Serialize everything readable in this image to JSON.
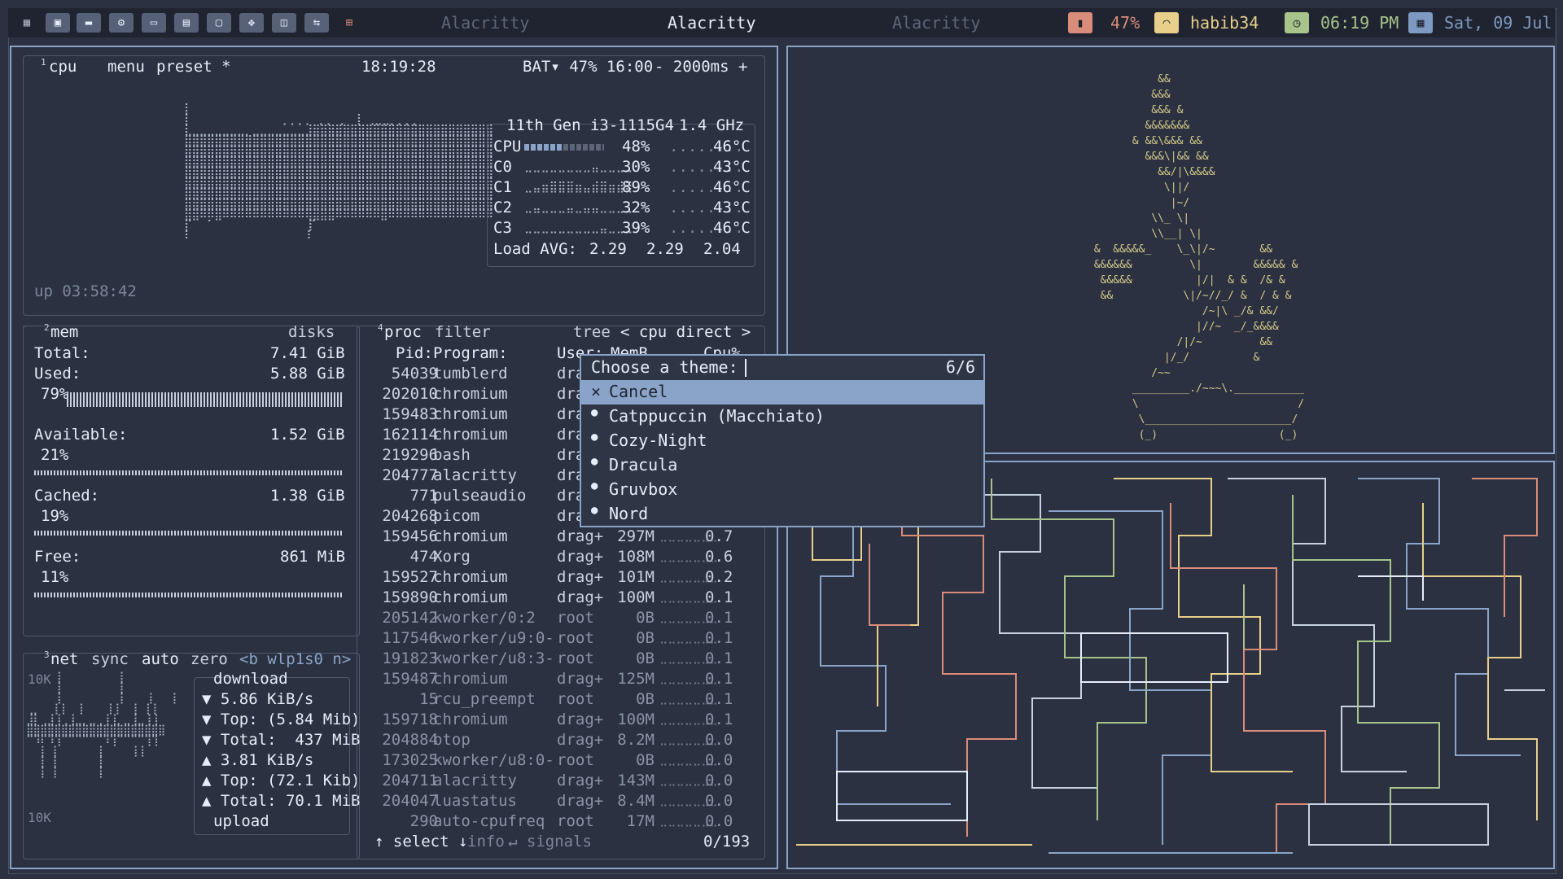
{
  "topbar": {
    "workspace_icons": [
      "grid-icon",
      "terminal-icon",
      "folder-icon",
      "gear-icon",
      "window-icon",
      "book-icon",
      "chat-icon",
      "move-icon",
      "display-icon",
      "swap-icon",
      "layout-icon"
    ],
    "window_titles": [
      "Alacritty",
      "Alacritty",
      "Alacritty"
    ],
    "battery": "47%",
    "wifi": "habib34",
    "time": "06:19 PM",
    "date": "Sat, 09 Jul",
    "colors": {
      "battery": "#d98c7a",
      "wifi": "#e8cf8a",
      "clock": "#a7c48a",
      "date": "#7f9ac2"
    }
  },
  "cpu_box": {
    "tab_num": "1",
    "title": "cpu",
    "menu": "menu",
    "preset": "preset *",
    "clock": "18:19:28",
    "battery": "BAT▾ 47% 16:00",
    "interval": "- 2000ms +",
    "uptime": "up 03:58:42",
    "cpu_model": "11th Gen i3-1115G4",
    "freq": "1.4 GHz",
    "cores": [
      {
        "name": "CPU",
        "pct": "48%",
        "temp": "46°C"
      },
      {
        "name": "C0",
        "pct": "30%",
        "temp": "43°C"
      },
      {
        "name": "C1",
        "pct": "89%",
        "temp": "46°C"
      },
      {
        "name": "C2",
        "pct": "32%",
        "temp": "43°C"
      },
      {
        "name": "C3",
        "pct": "39%",
        "temp": "46°C"
      }
    ],
    "load_label": "Load AVG:",
    "load": [
      "2.29",
      "2.29",
      "2.04"
    ]
  },
  "mem_box": {
    "tab_num": "2",
    "title": "mem",
    "disks": "disks",
    "rows": [
      {
        "label": "Total:",
        "value": "7.41 GiB",
        "pct": ""
      },
      {
        "label": "Used:",
        "value": "5.88 GiB",
        "pct": "79%"
      },
      {
        "label": "Available:",
        "value": "1.52 GiB",
        "pct": "21%"
      },
      {
        "label": "Cached:",
        "value": "1.38 GiB",
        "pct": "19%"
      },
      {
        "label": "Free:",
        "value": "861 MiB",
        "pct": "11%"
      }
    ]
  },
  "net_box": {
    "tab_num": "3",
    "title": "net",
    "sync": "sync",
    "auto": "auto",
    "zero": "zero",
    "iface": "<b wlp1s0 n>",
    "scale_top": "10K",
    "scale_bottom": "10K",
    "download_label": "download",
    "upload_label": "upload",
    "lines": [
      "▼ 5.86 KiB/s",
      "▼ Top: (5.84 Mib)",
      "▼ Total:  437 MiB",
      "▲ 3.81 KiB/s",
      "▲ Top: (72.1 Kib)",
      "▲ Total: 70.1 MiB"
    ]
  },
  "proc_box": {
    "tab_num": "4",
    "title": "proc",
    "filter": "filter",
    "tree": "tree",
    "sort": "< cpu direct >",
    "headers": {
      "pid": "Pid:",
      "program": "Program:",
      "user": "User:",
      "mem": "MemB",
      "cpu": "Cpu%"
    },
    "rows": [
      {
        "pid": "54039",
        "prog": "tumblerd",
        "user": "drag+",
        "mem": "",
        "cpu": ""
      },
      {
        "pid": "202010",
        "prog": "chromium",
        "user": "drag",
        "mem": "",
        "cpu": ""
      },
      {
        "pid": "159483",
        "prog": "chromium",
        "user": "drag",
        "mem": "",
        "cpu": ""
      },
      {
        "pid": "162114",
        "prog": "chromium",
        "user": "drag",
        "mem": "",
        "cpu": ""
      },
      {
        "pid": "219296",
        "prog": "bash",
        "user": "drag",
        "mem": "",
        "cpu": ""
      },
      {
        "pid": "204777",
        "prog": "alacritty",
        "user": "drag",
        "mem": "",
        "cpu": ""
      },
      {
        "pid": "771",
        "prog": "pulseaudio",
        "user": "drag",
        "mem": "",
        "cpu": ""
      },
      {
        "pid": "204268",
        "prog": "picom",
        "user": "drag",
        "mem": "",
        "cpu": ""
      },
      {
        "pid": "159456",
        "prog": "chromium",
        "user": "drag+",
        "mem": "297M",
        "cpu": "0.7"
      },
      {
        "pid": "474",
        "prog": "Xorg",
        "user": "drag+",
        "mem": "108M",
        "cpu": "0.6"
      },
      {
        "pid": "159527",
        "prog": "chromium",
        "user": "drag+",
        "mem": "101M",
        "cpu": "0.2"
      },
      {
        "pid": "159890",
        "prog": "chromium",
        "user": "drag+",
        "mem": "100M",
        "cpu": "0.1"
      },
      {
        "pid": "205142",
        "prog": "kworker/0:2",
        "user": "root",
        "mem": "0B",
        "cpu": "0.1"
      },
      {
        "pid": "117546",
        "prog": "kworker/u9:0-",
        "user": "root",
        "mem": "0B",
        "cpu": "0.1"
      },
      {
        "pid": "191823",
        "prog": "kworker/u8:3-",
        "user": "root",
        "mem": "0B",
        "cpu": "0.1"
      },
      {
        "pid": "159487",
        "prog": "chromium",
        "user": "drag+",
        "mem": "125M",
        "cpu": "0.1"
      },
      {
        "pid": "15",
        "prog": "rcu_preempt",
        "user": "root",
        "mem": "0B",
        "cpu": "0.1"
      },
      {
        "pid": "159718",
        "prog": "chromium",
        "user": "drag+",
        "mem": "100M",
        "cpu": "0.1"
      },
      {
        "pid": "204884",
        "prog": "btop",
        "user": "drag+",
        "mem": "8.2M",
        "cpu": "0.0"
      },
      {
        "pid": "173025",
        "prog": "kworker/u8:0-",
        "user": "root",
        "mem": "0B",
        "cpu": "0.0"
      },
      {
        "pid": "204711",
        "prog": "alacritty",
        "user": "drag+",
        "mem": "143M",
        "cpu": "0.0"
      },
      {
        "pid": "204047",
        "prog": "luastatus",
        "user": "drag+",
        "mem": "8.4M",
        "cpu": "0.0"
      },
      {
        "pid": "290",
        "prog": "auto-cpufreq",
        "user": "root",
        "mem": "17M",
        "cpu": "0.0"
      }
    ],
    "footer_select": "↑ select ↓",
    "footer_info": "info",
    "footer_signals": "↵ signals",
    "footer_count": "0/193"
  },
  "theme_popup": {
    "prompt": "Choose a theme:",
    "count": "6/6",
    "input_value": "",
    "options": [
      {
        "icon": "×",
        "label": "Cancel"
      },
      {
        "icon": "●",
        "label": "Catppuccin (Macchiato)"
      },
      {
        "icon": "●",
        "label": "Cozy-Night"
      },
      {
        "icon": "●",
        "label": "Dracula"
      },
      {
        "icon": "●",
        "label": "Gruvbox"
      },
      {
        "icon": "●",
        "label": "Nord"
      }
    ]
  }
}
